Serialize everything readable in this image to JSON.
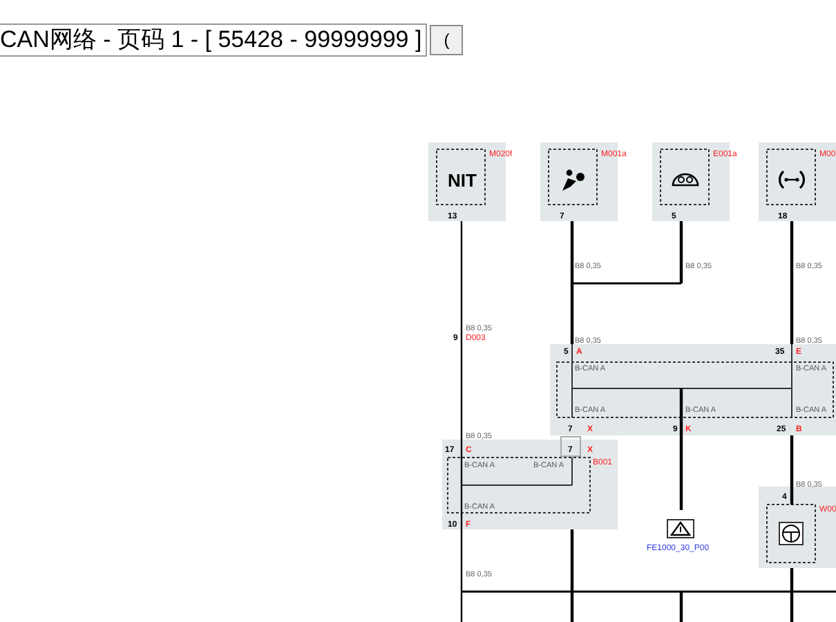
{
  "title_bar": {
    "title": "CAN网络 - 页码 1 - [ 55428 - 99999999 ]",
    "button": "("
  },
  "components": [
    {
      "code": "M020f",
      "pin": "13",
      "label": "NIT",
      "kind": "text"
    },
    {
      "code": "M001a",
      "pin": "7",
      "kind": "airbag"
    },
    {
      "code": "E001a",
      "pin": "5",
      "kind": "gauge"
    },
    {
      "code": "M00",
      "pin": "18",
      "kind": "tire"
    }
  ],
  "wire_specs": [
    "B8 0,35",
    "B8 0,35",
    "B8 0,35",
    "B8 0,35",
    "B8 0,35",
    "B8 0,35",
    "B8 0,35",
    "B8 0,35",
    "B8 0,35"
  ],
  "splice": {
    "pin": "9",
    "code": "D003"
  },
  "connector_e": {
    "pins": [
      {
        "number": "5",
        "letter": "A"
      },
      {
        "number": "35",
        "letter": "E"
      },
      {
        "number": "7",
        "letter": "X"
      },
      {
        "number": "9",
        "letter": "K"
      },
      {
        "number": "25",
        "letter": "B"
      }
    ],
    "signals": [
      "B-CAN A",
      "B-CAN A",
      "B-CAN A",
      "B-CAN A",
      "B-CAN A"
    ]
  },
  "bridge": {
    "number": "7",
    "letter": "X"
  },
  "module_b001": {
    "code": "B001",
    "pins": [
      {
        "number": "17",
        "letter": "C"
      },
      {
        "number": "10",
        "letter": "F"
      }
    ],
    "signals": [
      "B-CAN A",
      "B-CAN A",
      "B-CAN A"
    ]
  },
  "fault": {
    "label": "FE1000_30_P00"
  },
  "module_w00": {
    "code": "W00",
    "pin": "4"
  }
}
